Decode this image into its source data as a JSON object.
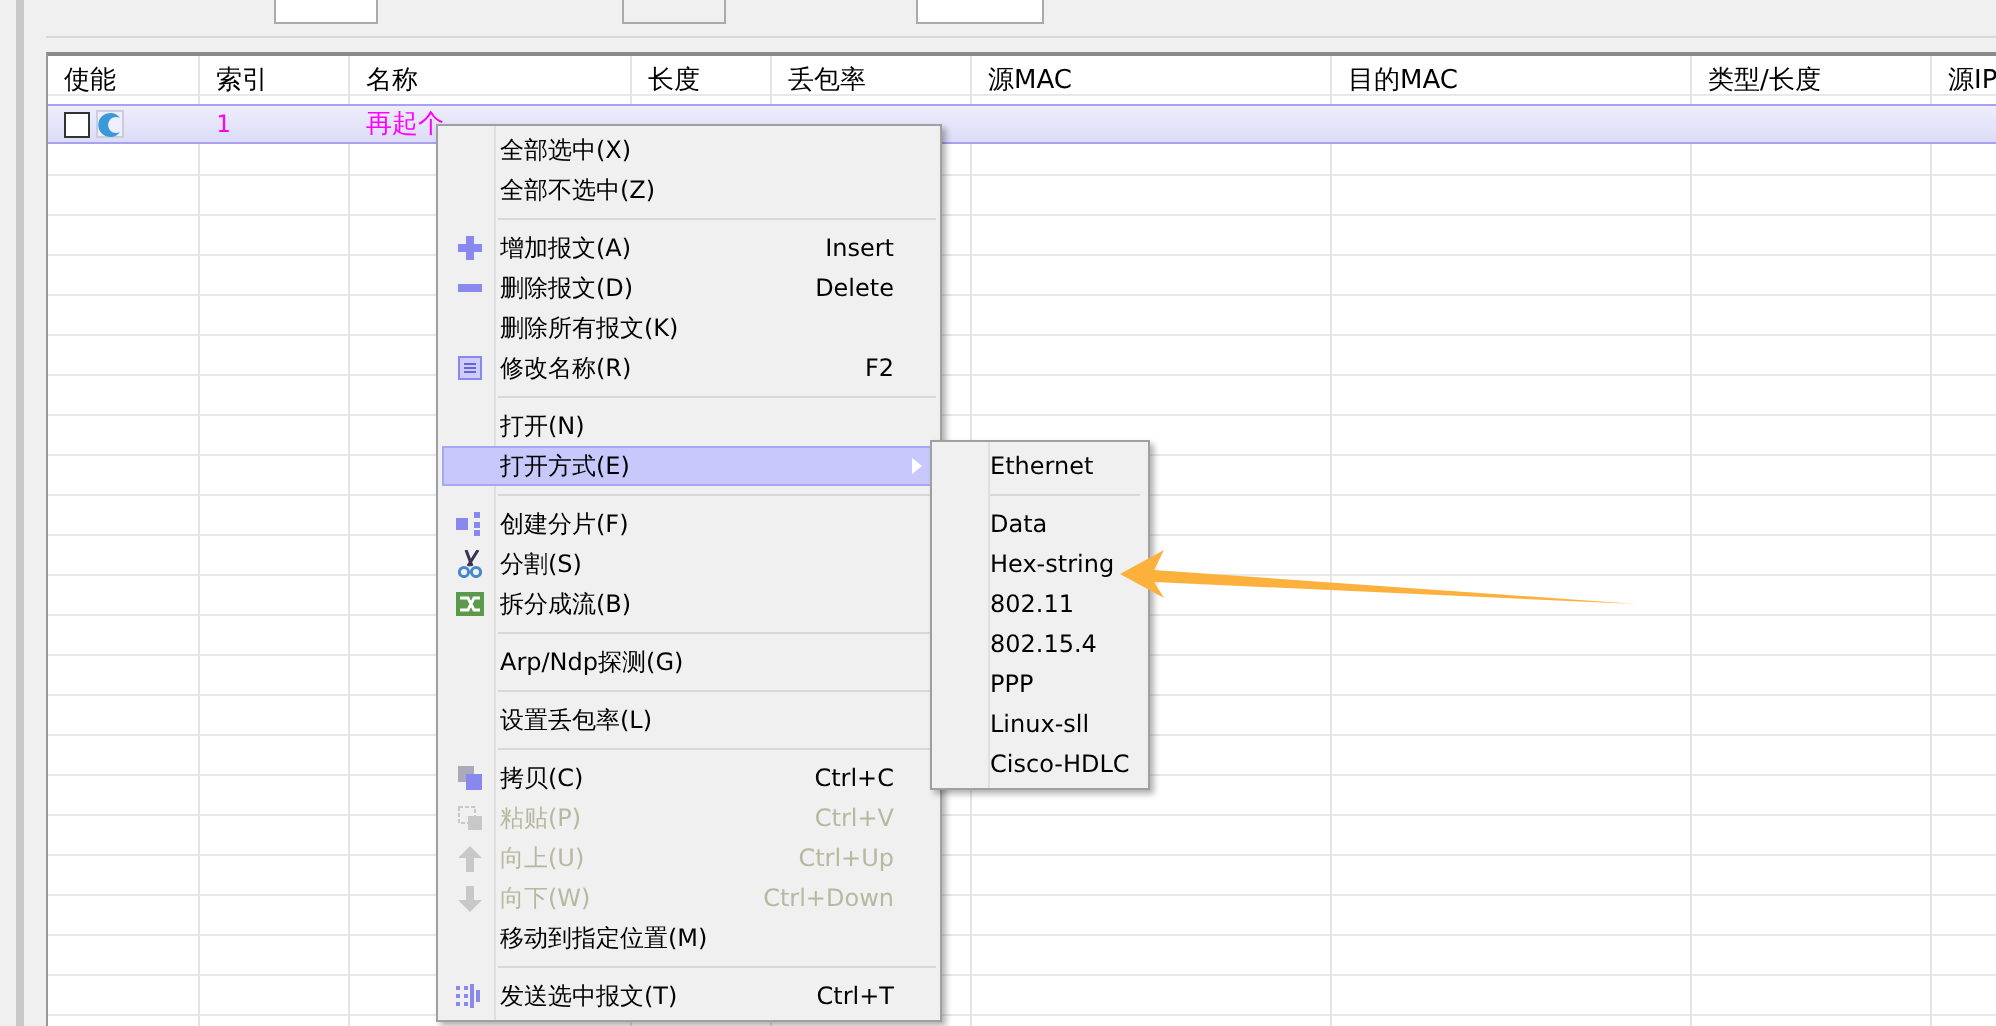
{
  "table": {
    "columns": [
      "使能",
      "索引",
      "名称",
      "长度",
      "丢包率",
      "源MAC",
      "目的MAC",
      "类型/长度",
      "源IP"
    ],
    "rows": [
      {
        "enabled": false,
        "selected": true,
        "index": "1",
        "name": "再起个"
      }
    ]
  },
  "context_menu": {
    "items": [
      {
        "kind": "item",
        "label": "全部选中(X)",
        "disabled": false,
        "selected": false
      },
      {
        "kind": "item",
        "label": "全部不选中(Z)",
        "disabled": false,
        "selected": false
      },
      {
        "kind": "separator"
      },
      {
        "kind": "item",
        "label": "增加报文(A)",
        "shortcut": "Insert",
        "disabled": false,
        "selected": false
      },
      {
        "kind": "item",
        "label": "删除报文(D)",
        "shortcut": "Delete",
        "disabled": false,
        "selected": false
      },
      {
        "kind": "item",
        "label": "删除所有报文(K)",
        "disabled": false,
        "selected": false
      },
      {
        "kind": "item",
        "label": "修改名称(R)",
        "shortcut": "F2",
        "disabled": false,
        "selected": false
      },
      {
        "kind": "separator"
      },
      {
        "kind": "item",
        "label": "打开(N)",
        "disabled": false,
        "selected": false
      },
      {
        "kind": "submenu",
        "label": "打开方式(E)",
        "disabled": false,
        "selected": true
      },
      {
        "kind": "separator"
      },
      {
        "kind": "item",
        "label": "创建分片(F)",
        "disabled": false,
        "selected": false
      },
      {
        "kind": "item",
        "label": "分割(S)",
        "disabled": false,
        "selected": false
      },
      {
        "kind": "item",
        "label": "拆分成流(B)",
        "disabled": false,
        "selected": false
      },
      {
        "kind": "separator"
      },
      {
        "kind": "item",
        "label": "Arp/Ndp探测(G)",
        "disabled": false,
        "selected": false
      },
      {
        "kind": "separator"
      },
      {
        "kind": "item",
        "label": "设置丢包率(L)",
        "disabled": false,
        "selected": false
      },
      {
        "kind": "separator"
      },
      {
        "kind": "item",
        "label": "拷贝(C)",
        "shortcut": "Ctrl+C",
        "disabled": false,
        "selected": false
      },
      {
        "kind": "item",
        "label": "粘贴(P)",
        "shortcut": "Ctrl+V",
        "disabled": true,
        "selected": false
      },
      {
        "kind": "item",
        "label": "向上(U)",
        "shortcut": "Ctrl+Up",
        "disabled": true,
        "selected": false
      },
      {
        "kind": "item",
        "label": "向下(W)",
        "shortcut": "Ctrl+Down",
        "disabled": true,
        "selected": false
      },
      {
        "kind": "item",
        "label": "移动到指定位置(M)",
        "disabled": false,
        "selected": false
      },
      {
        "kind": "separator"
      },
      {
        "kind": "item",
        "label": "发送选中报文(T)",
        "shortcut": "Ctrl+T",
        "disabled": false,
        "selected": false
      }
    ]
  },
  "submenu": {
    "items": [
      {
        "kind": "item",
        "label": "Ethernet"
      },
      {
        "kind": "separator"
      },
      {
        "kind": "item",
        "label": "Data"
      },
      {
        "kind": "item",
        "label": "Hex-string"
      },
      {
        "kind": "item",
        "label": "802.11"
      },
      {
        "kind": "item",
        "label": "802.15.4"
      },
      {
        "kind": "item",
        "label": "PPP"
      },
      {
        "kind": "item",
        "label": "Linux-sll"
      },
      {
        "kind": "item",
        "label": "Cisco-HDLC"
      }
    ]
  }
}
